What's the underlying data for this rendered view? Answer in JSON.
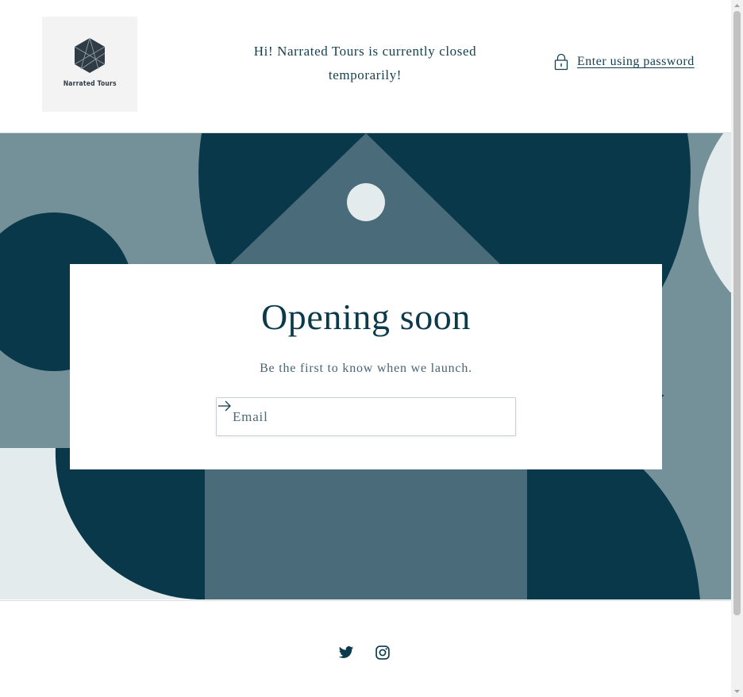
{
  "header": {
    "logo_text": "Narrated Tours",
    "announcement": "Hi! Narrated Tours is currently closed temporarily!",
    "password_link": "Enter using password",
    "lock_icon": "lock-icon"
  },
  "hero": {
    "title": "Opening soon",
    "subtitle": "Be the first to know when we launch.",
    "email_placeholder": "Email",
    "submit_icon": "arrow-right-icon"
  },
  "footer": {
    "social_icons": [
      "twitter-icon",
      "instagram-icon"
    ]
  },
  "colors": {
    "dark_teal": "#08384a",
    "mid_teal": "#4a6b79",
    "slate": "#74919a",
    "light": "#e3ebed",
    "text": "#123f4f"
  }
}
